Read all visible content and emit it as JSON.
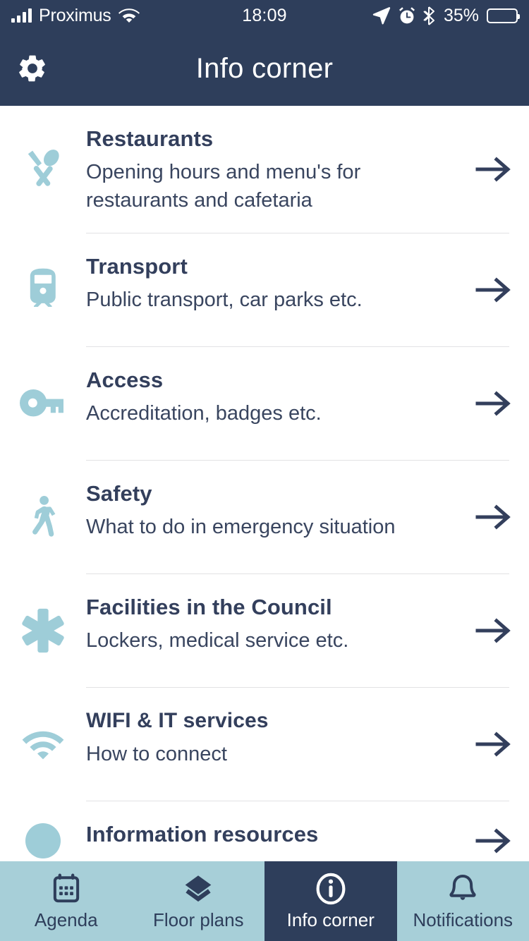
{
  "status_bar": {
    "carrier": "Proximus",
    "time": "18:09",
    "battery_percent": "35%",
    "battery_level": 35,
    "icons": [
      "signal-bars-icon",
      "wifi-icon",
      "location-arrow-icon",
      "alarm-clock-icon",
      "bluetooth-icon",
      "battery-icon"
    ]
  },
  "header": {
    "title": "Info corner",
    "settings_icon": "gear-icon"
  },
  "colors": {
    "header_bg": "#2e3e5b",
    "tabbar_bg": "#a7cfd8",
    "accent_icon": "#9ecdd8",
    "title_text": "#333f5c",
    "divider": "#e2e2e4",
    "active_tab_bg": "#2e3e5b"
  },
  "list": {
    "items": [
      {
        "title": "Restaurants",
        "subtitle": "Opening hours and menu's for restaurants and cafetaria",
        "icon": "cutlery-icon",
        "arrow": "arrow-right-icon"
      },
      {
        "title": "Transport",
        "subtitle": "Public transport, car parks etc.",
        "icon": "train-icon",
        "arrow": "arrow-right-icon"
      },
      {
        "title": "Access",
        "subtitle": "Accreditation, badges etc.",
        "icon": "key-icon",
        "arrow": "arrow-right-icon"
      },
      {
        "title": "Safety",
        "subtitle": "What to do in emergency situation",
        "icon": "walking-person-icon",
        "arrow": "arrow-right-icon"
      },
      {
        "title": "Facilities in the Council",
        "subtitle": "Lockers, medical service etc.",
        "icon": "asterisk-icon",
        "arrow": "arrow-right-icon"
      },
      {
        "title": "WIFI & IT services",
        "subtitle": "How to connect",
        "icon": "wifi-icon",
        "arrow": "arrow-right-icon"
      },
      {
        "title": "Information resources",
        "subtitle": "",
        "icon": "info-bubble-icon",
        "arrow": "arrow-right-icon"
      }
    ]
  },
  "tabbar": {
    "tabs": [
      {
        "label": "Agenda",
        "icon": "calendar-icon",
        "active": false
      },
      {
        "label": "Floor plans",
        "icon": "layers-icon",
        "active": false
      },
      {
        "label": "Info corner",
        "icon": "info-circle-icon",
        "active": true
      },
      {
        "label": "Notifications",
        "icon": "bell-icon",
        "active": false
      }
    ]
  }
}
